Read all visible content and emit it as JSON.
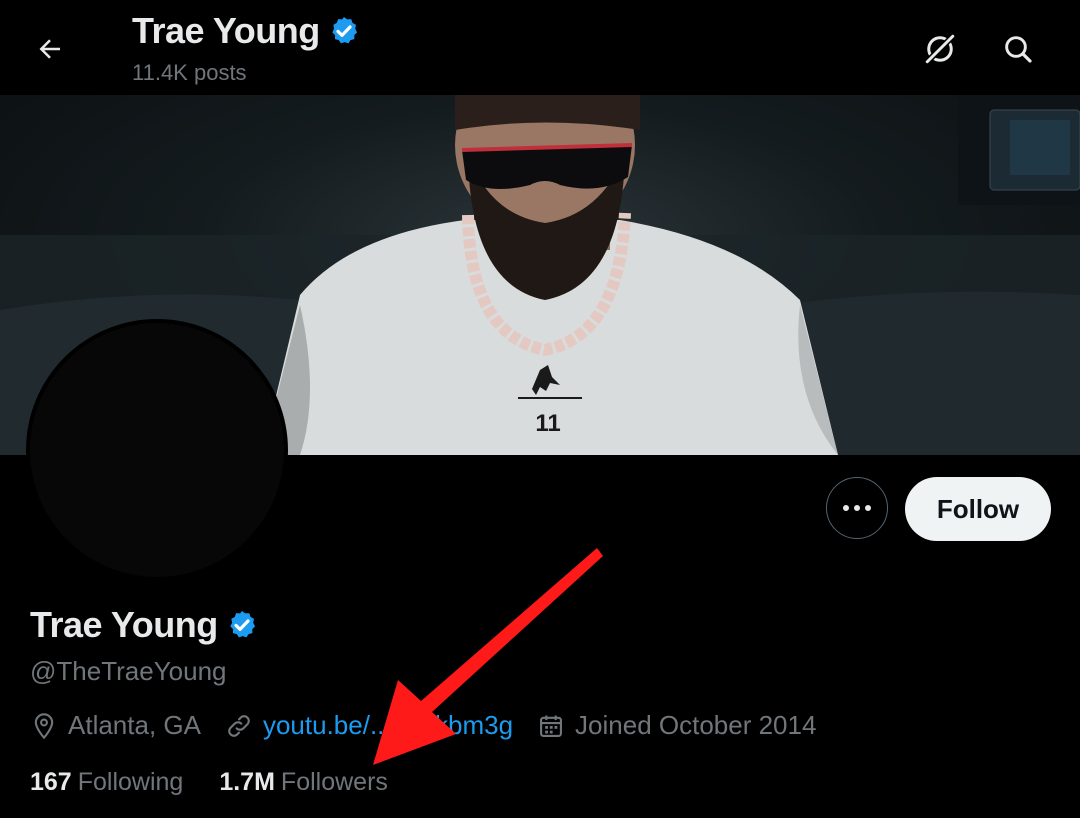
{
  "header": {
    "title": "Trae Young",
    "posts_count": "11.4K posts",
    "verified_icon": "verified-badge-icon",
    "back_icon": "back-arrow-icon",
    "grok_icon": "grok-icon",
    "search_icon": "search-icon"
  },
  "banner": {
    "jersey_number": "11"
  },
  "actions": {
    "more_icon": "more-options-icon",
    "follow_label": "Follow"
  },
  "profile": {
    "name": "Trae Young",
    "handle": "@TheTraeYoung",
    "location": "Atlanta, GA",
    "website": "youtu.be/...hn9kbm3g",
    "joined": "Joined October 2014",
    "location_icon": "location-pin-icon",
    "link_icon": "link-icon",
    "calendar_icon": "calendar-icon"
  },
  "stats": {
    "following_count": "167",
    "following_label": "Following",
    "followers_count": "1.7M",
    "followers_label": "Followers"
  },
  "colors": {
    "background": "#000000",
    "text_primary": "#e7e9ea",
    "text_secondary": "#71767b",
    "link": "#1d9bf0",
    "verified": "#1d9bf0",
    "annotation_arrow": "#ff1a1a"
  }
}
